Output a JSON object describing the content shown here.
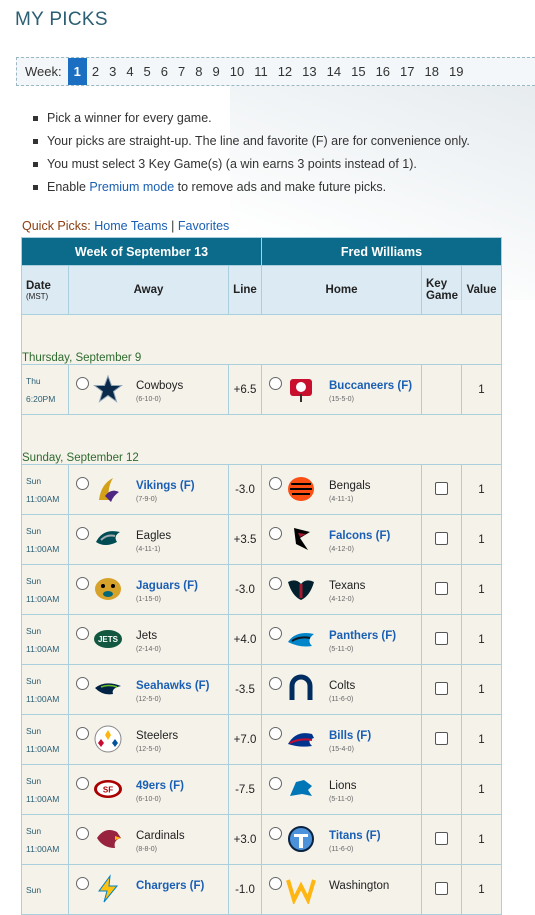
{
  "page_title": "MY PICKS",
  "weeks": {
    "label": "Week:",
    "items": [
      "1",
      "2",
      "3",
      "4",
      "5",
      "6",
      "7",
      "8",
      "9",
      "10",
      "11",
      "12",
      "13",
      "14",
      "15",
      "16",
      "17",
      "18",
      "19"
    ],
    "current": "1"
  },
  "rules": [
    {
      "text": "Pick a winner for every game."
    },
    {
      "text": "Your picks are straight-up. The line and favorite (F) are for convenience only."
    },
    {
      "text": "You must select 3 Key Game(s) (a win earns 3 points instead of 1)."
    },
    {
      "pre": "Enable ",
      "link": "Premium mode",
      "post": " to remove ads and make future picks."
    }
  ],
  "quick_picks": {
    "label": "Quick Picks:",
    "home": "Home Teams",
    "sep": "|",
    "fav": "Favorites"
  },
  "table": {
    "week_title": "Week of September 13",
    "player": "Fred Williams",
    "headers": {
      "date": "Date",
      "date_sub": "(MST)",
      "away": "Away",
      "line": "Line",
      "home": "Home",
      "key1": "Key",
      "key2": "Game",
      "value": "Value"
    },
    "sections": [
      {
        "title": "Thursday, September 9",
        "games": [
          {
            "day": "Thu",
            "time": "6:20PM",
            "away": "Cowboys",
            "away_rec": "(6-10-0)",
            "away_icon": "star-logo-icon",
            "line": "+6.5",
            "home": "Buccaneers (F)",
            "home_rec": "(15-5-0)",
            "home_icon": "flag-logo-icon",
            "fav": "home",
            "key": false,
            "value": "1"
          }
        ]
      },
      {
        "title": "Sunday, September 12",
        "games": [
          {
            "day": "Sun",
            "time": "11:00AM",
            "away": "Vikings (F)",
            "away_rec": "(7-9-0)",
            "away_icon": "viking-horn-icon",
            "line": "-3.0",
            "home": "Bengals",
            "home_rec": "(4-11-1)",
            "home_icon": "tiger-head-icon",
            "fav": "away",
            "key": true,
            "value": "1"
          },
          {
            "day": "Sun",
            "time": "11:00AM",
            "away": "Eagles",
            "away_rec": "(4-11-1)",
            "away_icon": "eagle-head-icon",
            "line": "+3.5",
            "home": "Falcons (F)",
            "home_rec": "(4-12-0)",
            "home_icon": "falcon-icon",
            "fav": "home",
            "key": true,
            "value": "1"
          },
          {
            "day": "Sun",
            "time": "11:00AM",
            "away": "Jaguars (F)",
            "away_rec": "(1-15-0)",
            "away_icon": "jaguar-head-icon",
            "line": "-3.0",
            "home": "Texans",
            "home_rec": "(4-12-0)",
            "home_icon": "bull-head-icon",
            "fav": "away",
            "key": true,
            "value": "1"
          },
          {
            "day": "Sun",
            "time": "11:00AM",
            "away": "Jets",
            "away_rec": "(2-14-0)",
            "away_icon": "jets-oval-icon",
            "line": "+4.0",
            "home": "Panthers (F)",
            "home_rec": "(5-11-0)",
            "home_icon": "panther-head-icon",
            "fav": "home",
            "key": true,
            "value": "1"
          },
          {
            "day": "Sun",
            "time": "11:00AM",
            "away": "Seahawks (F)",
            "away_rec": "(12-5-0)",
            "away_icon": "seahawk-head-icon",
            "line": "-3.5",
            "home": "Colts",
            "home_rec": "(11-6-0)",
            "home_icon": "horseshoe-icon",
            "fav": "away",
            "key": true,
            "value": "1"
          },
          {
            "day": "Sun",
            "time": "11:00AM",
            "away": "Steelers",
            "away_rec": "(12-5-0)",
            "away_icon": "steelmark-icon",
            "line": "+7.0",
            "home": "Bills (F)",
            "home_rec": "(15-4-0)",
            "home_icon": "bison-icon",
            "fav": "home",
            "key": true,
            "value": "1"
          },
          {
            "day": "Sun",
            "time": "11:00AM",
            "away": "49ers (F)",
            "away_rec": "(6-10-0)",
            "away_icon": "sf-oval-icon",
            "line": "-7.5",
            "home": "Lions",
            "home_rec": "(5-11-0)",
            "home_icon": "lion-icon",
            "fav": "away",
            "key": false,
            "value": "1"
          },
          {
            "day": "Sun",
            "time": "11:00AM",
            "away": "Cardinals",
            "away_rec": "(8-8-0)",
            "away_icon": "cardinal-head-icon",
            "line": "+3.0",
            "home": "Titans (F)",
            "home_rec": "(11-6-0)",
            "home_icon": "titans-t-icon",
            "fav": "home",
            "key": true,
            "value": "1"
          },
          {
            "day": "Sun",
            "time": "",
            "away": "Chargers (F)",
            "away_rec": "",
            "away_icon": "bolt-icon",
            "line": "-1.0",
            "home": "Washington",
            "home_rec": "",
            "home_icon": "w-logo-icon",
            "fav": "away",
            "key": true,
            "value": "1"
          }
        ]
      }
    ]
  },
  "colors": {
    "accent": "#0c6b8a",
    "link": "#1a5fb4",
    "row_bg": "#f5f2ea",
    "section_text": "#2f6b2f"
  }
}
